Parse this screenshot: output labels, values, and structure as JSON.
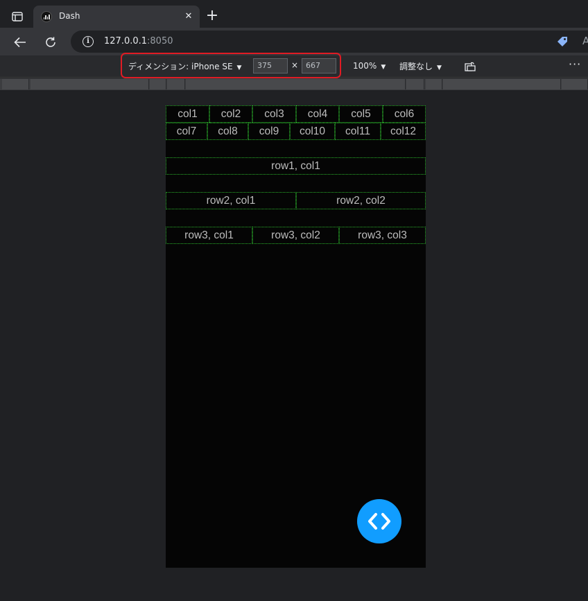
{
  "browser": {
    "tab": {
      "title": "Dash",
      "close": "✕"
    },
    "new_tab": "+",
    "address": {
      "host": "127.0.0.1",
      "port": ":8050"
    },
    "reader_text": "A"
  },
  "device_toolbar": {
    "dimensions_label": "ディメンション: iPhone SE",
    "width": "375",
    "height": "667",
    "times": "×",
    "zoom": "100%",
    "throttle": "調整なし",
    "more": "···"
  },
  "page": {
    "grid_row_a": [
      "col1",
      "col2",
      "col3",
      "col4",
      "col5",
      "col6"
    ],
    "grid_row_b": [
      "col7",
      "col8",
      "col9",
      "col10",
      "col11",
      "col12"
    ],
    "row1": [
      "row1, col1"
    ],
    "row2": [
      "row2, col1",
      "row2, col2"
    ],
    "row3": [
      "row3, col1",
      "row3, col2",
      "row3, col3"
    ]
  },
  "colors": {
    "grid_border": "#2bb52b",
    "fab": "#119dff",
    "highlight": "#e01b24"
  },
  "icons": [
    "tab-actions-icon",
    "dash-favicon-icon",
    "close-icon",
    "plus-icon",
    "back-arrow-icon",
    "reload-icon",
    "info-icon",
    "tag-icon",
    "dropdown-arrow-icon",
    "rotate-icon",
    "more-icon",
    "code-brackets-icon"
  ]
}
